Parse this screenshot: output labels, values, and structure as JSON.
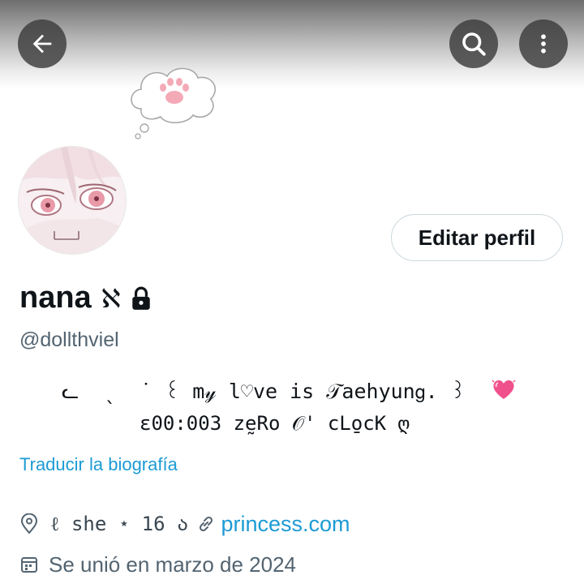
{
  "header": {
    "back_icon": "arrow-left-icon",
    "search_icon": "search-icon",
    "more_icon": "more-vertical-icon"
  },
  "profile": {
    "name": "nana",
    "name_symbol": "ℵ",
    "handle": "@dollthviel",
    "edit_button": "Editar perfil",
    "bio_line1": "ᓚ  ˎ  ˙ ꒰ m𝓎 l♡ve is 𝒯aehyun𝗀. ꒱",
    "bio_line2": "ɛ00:003 zḛRo 𝒪' cLo̱cK ღ",
    "translate_link": "Traducir la biografía",
    "location": "ℓ she ⋆ 16 ა",
    "website": "princess.com",
    "joined": "Se unió en marzo de 2024"
  },
  "colors": {
    "link": "#1d9bd4",
    "secondary_text": "#536471",
    "heart": "#f0508c"
  }
}
